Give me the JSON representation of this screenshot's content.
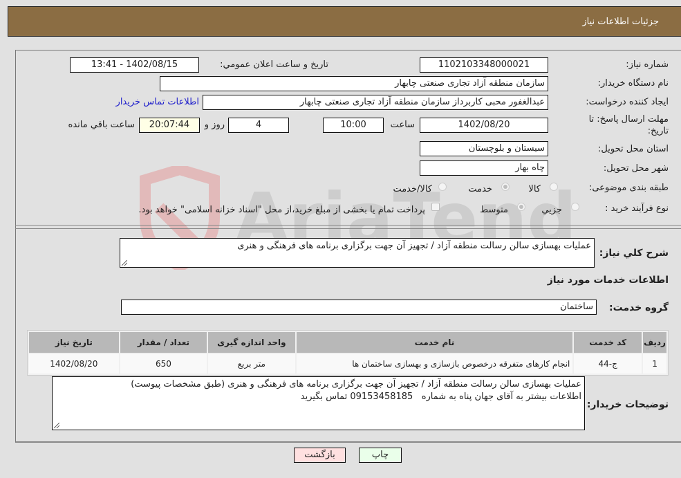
{
  "header": {
    "title": "جزئيات اطلاعات نياز"
  },
  "fields": {
    "need_number_label": "شماره نياز:",
    "need_number": "1102103348000021",
    "announce_label": "تاريخ و ساعت اعلان عمومي:",
    "announce_value": "1402/08/15 - 13:41",
    "buyer_org_label": "نام دستگاه خريدار:",
    "buyer_org": "سازمان منطقه آزاد تجاری صنعتی چابهار",
    "creator_label": "ايجاد کننده درخواست:",
    "creator": "عبدالغفور محبی کاربرداز سازمان منطقه آزاد تجاری صنعتی چابهار",
    "contact_link": "اطلاعات تماس خريدار",
    "deadline_label_1": "مهلت ارسال پاسخ: تا",
    "deadline_label_2": "تاريخ:",
    "deadline_date": "1402/08/20",
    "time_label": "ساعت",
    "deadline_time": "10:00",
    "days_value": "4",
    "days_label": "روز و",
    "remaining_time": "20:07:44",
    "remaining_label": "ساعت باقي مانده",
    "province_label": "استان محل تحويل:",
    "province": "سيستان و بلوچستان",
    "city_label": "شهر محل تحويل:",
    "city": "چاه بهار",
    "category_label": "طبقه بندی موضوعی:",
    "category_options": [
      {
        "label": "کالا",
        "checked": false
      },
      {
        "label": "خدمت",
        "checked": true
      },
      {
        "label": "کالا/خدمت",
        "checked": false
      }
    ],
    "process_label": "نوع فرآيند خريد :",
    "process_options": [
      {
        "label": "جزيي",
        "checked": false
      },
      {
        "label": "متوسط",
        "checked": true
      }
    ],
    "treasury_note": "پرداخت تمام يا بخشی از مبلغ خريد،از محل \"اسناد خزانه اسلامی\" خواهد بود."
  },
  "summary": {
    "label": "شرح کلي نياز:",
    "value": "عمليات بهسازی سالن رسالت منطقه آزاد / تجهيز آن جهت برگزاری برنامه های فرهنگی و هنری"
  },
  "services": {
    "section_title": "اطلاعات خدمات مورد نياز",
    "group_label": "گروه خدمت:",
    "group_value": "ساختمان",
    "columns": [
      "رديف",
      "کد خدمت",
      "نام خدمت",
      "واحد اندازه گيری",
      "تعداد / مقدار",
      "تاريخ نياز"
    ],
    "rows": [
      [
        "1",
        "ج-44",
        "انجام کارهای متفرقه درخصوص بازسازی و بهسازی ساختمان ها",
        "متر بربع",
        "650",
        "1402/08/20"
      ]
    ]
  },
  "buyer_notes": {
    "label": "توضيحات خريدار:",
    "line1": "عمليات بهسازی سالن رسالت منطقه آزاد / تجهيز آن جهت برگزاری برنامه های فرهنگی و هنری (طبق مشخصات پيوست)",
    "line2": "اطلاعات بيشتر به آقای جهان پناه به شماره   09153458185 تماس بگيريد"
  },
  "buttons": {
    "print": "چاپ",
    "back": "بازگشت"
  },
  "colors": {
    "header_bg": "#8b6d43",
    "print_bg": "#eaffea",
    "back_bg": "#ffe0e0",
    "link": "#2222cc"
  }
}
